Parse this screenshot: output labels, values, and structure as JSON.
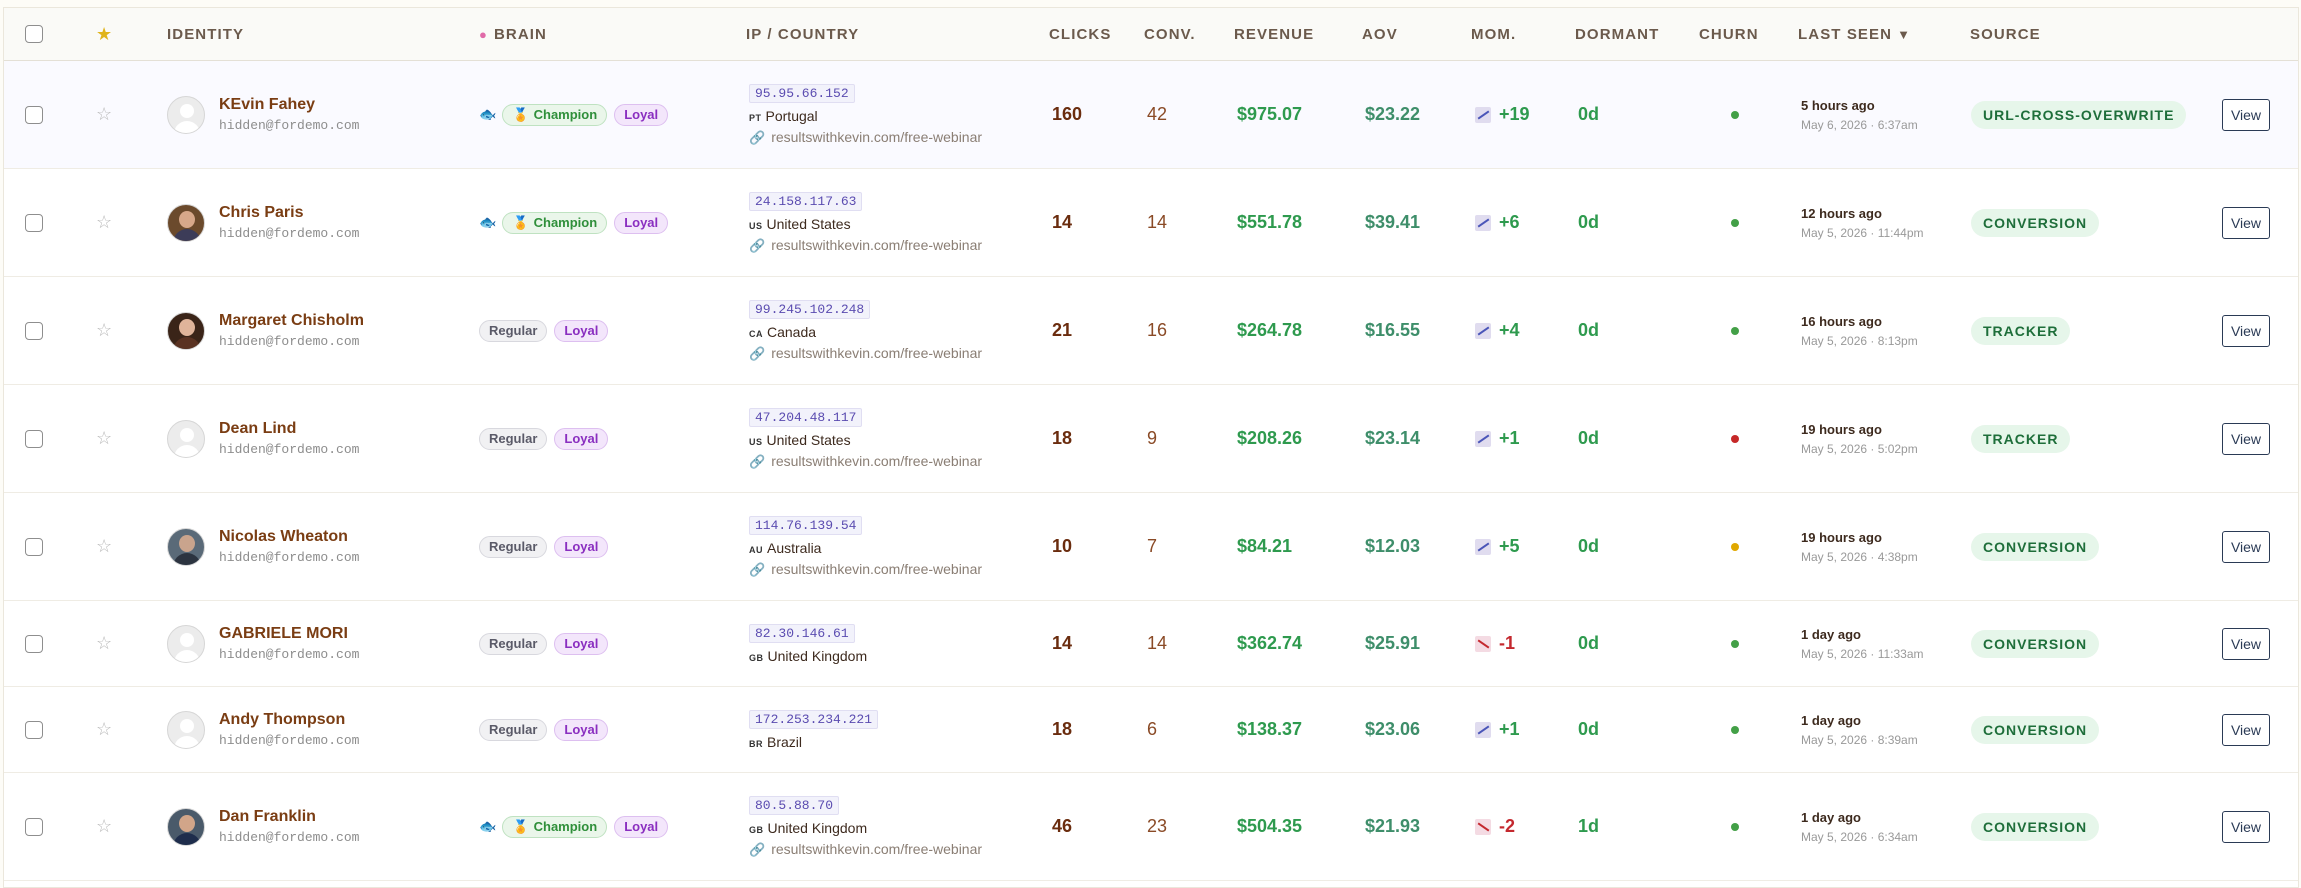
{
  "header": {
    "identity": "IDENTITY",
    "brain_icon": "brain-icon",
    "brain": "BRAIN",
    "ip_country": "IP / COUNTRY",
    "clicks": "CLICKS",
    "conv": "CONV.",
    "revenue": "REVENUE",
    "aov": "AOV",
    "mom": "MOM.",
    "dormant": "DORMANT",
    "churn": "CHURN",
    "last_seen": "LAST SEEN",
    "last_seen_sort": "▼",
    "source": "SOURCE"
  },
  "colors": {
    "accent_name": "#7a3d13",
    "revenue_green": "#2e9a4e",
    "churn_green": "#43a047",
    "churn_red": "#c62828",
    "churn_yellow": "#e0a800",
    "loyal_purple": "#8a2ec0"
  },
  "rows": [
    {
      "name": "KEvin Fahey",
      "email": "hidden@fordemo.com",
      "avatar": "placeholder",
      "brain": [
        "Champion",
        "Loyal"
      ],
      "brain_icon": "fish-icon",
      "ip": "95.95.66.152",
      "cc": "PT",
      "country": "Portugal",
      "url": "resultswithkevin.com/free-webinar",
      "clicks": "160",
      "conv": "42",
      "revenue": "$975.07",
      "aov": "$23.22",
      "mom": "+19",
      "mom_dir": "up",
      "dormant": "0d",
      "churn": "green",
      "seen_rel": "5 hours ago",
      "seen_abs": "May 6, 2026 · 6:37am",
      "source": "URL-CROSS-OVERWRITE",
      "view": "View"
    },
    {
      "name": "Chris Paris",
      "email": "hidden@fordemo.com",
      "avatar": "photo",
      "brain": [
        "Champion",
        "Loyal"
      ],
      "brain_icon": "fish-icon",
      "ip": "24.158.117.63",
      "cc": "US",
      "country": "United States",
      "url": "resultswithkevin.com/free-webinar",
      "clicks": "14",
      "conv": "14",
      "revenue": "$551.78",
      "aov": "$39.41",
      "mom": "+6",
      "mom_dir": "up",
      "dormant": "0d",
      "churn": "green",
      "seen_rel": "12 hours ago",
      "seen_abs": "May 5, 2026 · 11:44pm",
      "source": "CONVERSION",
      "view": "View"
    },
    {
      "name": "Margaret Chisholm",
      "email": "hidden@fordemo.com",
      "avatar": "photo",
      "brain": [
        "Regular",
        "Loyal"
      ],
      "brain_icon": "",
      "ip": "99.245.102.248",
      "cc": "CA",
      "country": "Canada",
      "url": "resultswithkevin.com/free-webinar",
      "clicks": "21",
      "conv": "16",
      "revenue": "$264.78",
      "aov": "$16.55",
      "mom": "+4",
      "mom_dir": "up",
      "dormant": "0d",
      "churn": "green",
      "seen_rel": "16 hours ago",
      "seen_abs": "May 5, 2026 · 8:13pm",
      "source": "TRACKER",
      "view": "View"
    },
    {
      "name": "Dean Lind",
      "email": "hidden@fordemo.com",
      "avatar": "placeholder",
      "brain": [
        "Regular",
        "Loyal"
      ],
      "brain_icon": "",
      "ip": "47.204.48.117",
      "cc": "US",
      "country": "United States",
      "url": "resultswithkevin.com/free-webinar",
      "clicks": "18",
      "conv": "9",
      "revenue": "$208.26",
      "aov": "$23.14",
      "mom": "+1",
      "mom_dir": "up",
      "dormant": "0d",
      "churn": "red",
      "seen_rel": "19 hours ago",
      "seen_abs": "May 5, 2026 · 5:02pm",
      "source": "TRACKER",
      "view": "View"
    },
    {
      "name": "Nicolas Wheaton",
      "email": "hidden@fordemo.com",
      "avatar": "photo",
      "brain": [
        "Regular",
        "Loyal"
      ],
      "brain_icon": "",
      "ip": "114.76.139.54",
      "cc": "AU",
      "country": "Australia",
      "url": "resultswithkevin.com/free-webinar",
      "clicks": "10",
      "conv": "7",
      "revenue": "$84.21",
      "aov": "$12.03",
      "mom": "+5",
      "mom_dir": "up",
      "dormant": "0d",
      "churn": "yellow",
      "seen_rel": "19 hours ago",
      "seen_abs": "May 5, 2026 · 4:38pm",
      "source": "CONVERSION",
      "view": "View"
    },
    {
      "name": "GABRIELE MORI",
      "email": "hidden@fordemo.com",
      "avatar": "placeholder",
      "brain": [
        "Regular",
        "Loyal"
      ],
      "brain_icon": "",
      "ip": "82.30.146.61",
      "cc": "GB",
      "country": "United Kingdom",
      "url": "",
      "clicks": "14",
      "conv": "14",
      "revenue": "$362.74",
      "aov": "$25.91",
      "mom": "-1",
      "mom_dir": "down",
      "dormant": "0d",
      "churn": "green",
      "seen_rel": "1 day ago",
      "seen_abs": "May 5, 2026 · 11:33am",
      "source": "CONVERSION",
      "view": "View"
    },
    {
      "name": "Andy Thompson",
      "email": "hidden@fordemo.com",
      "avatar": "placeholder",
      "brain": [
        "Regular",
        "Loyal"
      ],
      "brain_icon": "",
      "ip": "172.253.234.221",
      "cc": "BR",
      "country": "Brazil",
      "url": "",
      "clicks": "18",
      "conv": "6",
      "revenue": "$138.37",
      "aov": "$23.06",
      "mom": "+1",
      "mom_dir": "up",
      "dormant": "0d",
      "churn": "green",
      "seen_rel": "1 day ago",
      "seen_abs": "May 5, 2026 · 8:39am",
      "source": "CONVERSION",
      "view": "View"
    },
    {
      "name": "Dan Franklin",
      "email": "hidden@fordemo.com",
      "avatar": "photo",
      "brain": [
        "Champion",
        "Loyal"
      ],
      "brain_icon": "fish-icon",
      "ip": "80.5.88.70",
      "cc": "GB",
      "country": "United Kingdom",
      "url": "resultswithkevin.com/free-webinar",
      "clicks": "46",
      "conv": "23",
      "revenue": "$504.35",
      "aov": "$21.93",
      "mom": "-2",
      "mom_dir": "down",
      "dormant": "1d",
      "churn": "green",
      "seen_rel": "1 day ago",
      "seen_abs": "May 5, 2026 · 6:34am",
      "source": "CONVERSION",
      "view": "View"
    }
  ]
}
